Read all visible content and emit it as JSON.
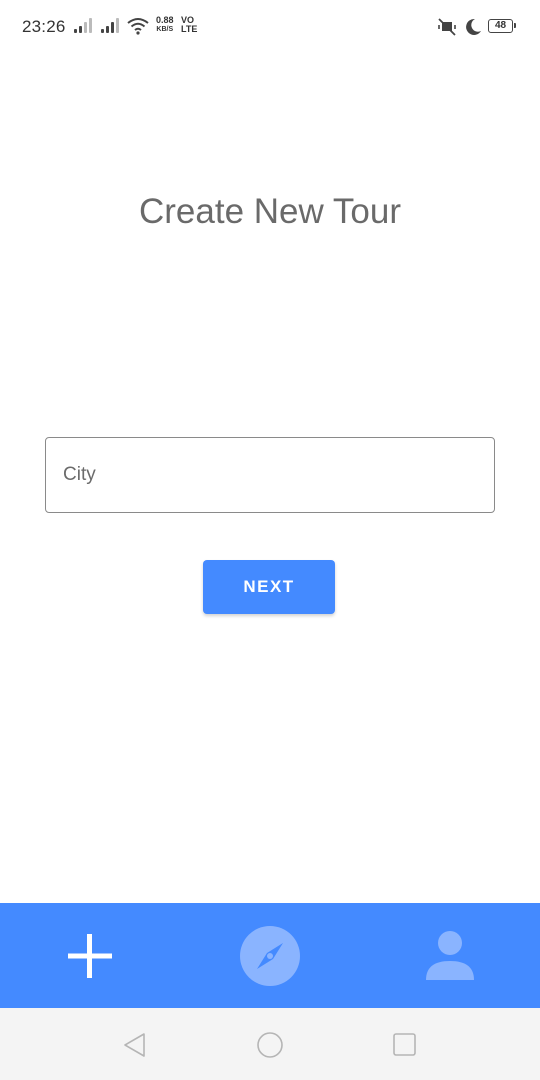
{
  "status_bar": {
    "time": "23:26",
    "net_speed_value": "0.88",
    "net_speed_unit": "KB/S",
    "volte_top": "VO",
    "volte_bottom": "LTE",
    "battery_level": "48",
    "icons": [
      "signal-icon",
      "signal-icon",
      "wifi-icon",
      "mute-icon",
      "moon-icon",
      "battery-icon"
    ]
  },
  "main": {
    "title": "Create New Tour",
    "city_input": {
      "placeholder": "City",
      "value": ""
    },
    "next_button_label": "NEXT"
  },
  "bottom_nav": {
    "items": [
      {
        "icon": "add-icon"
      },
      {
        "icon": "compass-icon"
      },
      {
        "icon": "person-icon"
      }
    ],
    "background": "#448aff"
  },
  "system_nav": {
    "icons": [
      "back-icon",
      "home-icon",
      "recents-icon"
    ]
  },
  "colors": {
    "accent": "#448aff",
    "title_text": "#6a6a6a"
  }
}
